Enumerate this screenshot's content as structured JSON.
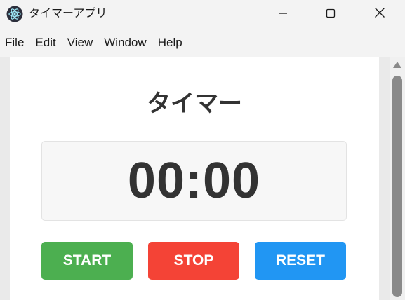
{
  "window": {
    "title": "タイマーアプリ",
    "controls": {
      "minimize": "minimize",
      "maximize": "maximize",
      "close": "close"
    }
  },
  "menu": {
    "items": [
      "File",
      "Edit",
      "View",
      "Window",
      "Help"
    ]
  },
  "main": {
    "heading": "タイマー",
    "time": "00:00",
    "buttons": {
      "start": "START",
      "stop": "STOP",
      "reset": "RESET"
    }
  },
  "colors": {
    "start": "#4caf50",
    "stop": "#f44336",
    "reset": "#2196f3",
    "text": "#333333"
  },
  "icons": {
    "app": "electron-app-icon",
    "minimize": "minimize-icon",
    "maximize": "maximize-icon",
    "close": "close-icon"
  }
}
